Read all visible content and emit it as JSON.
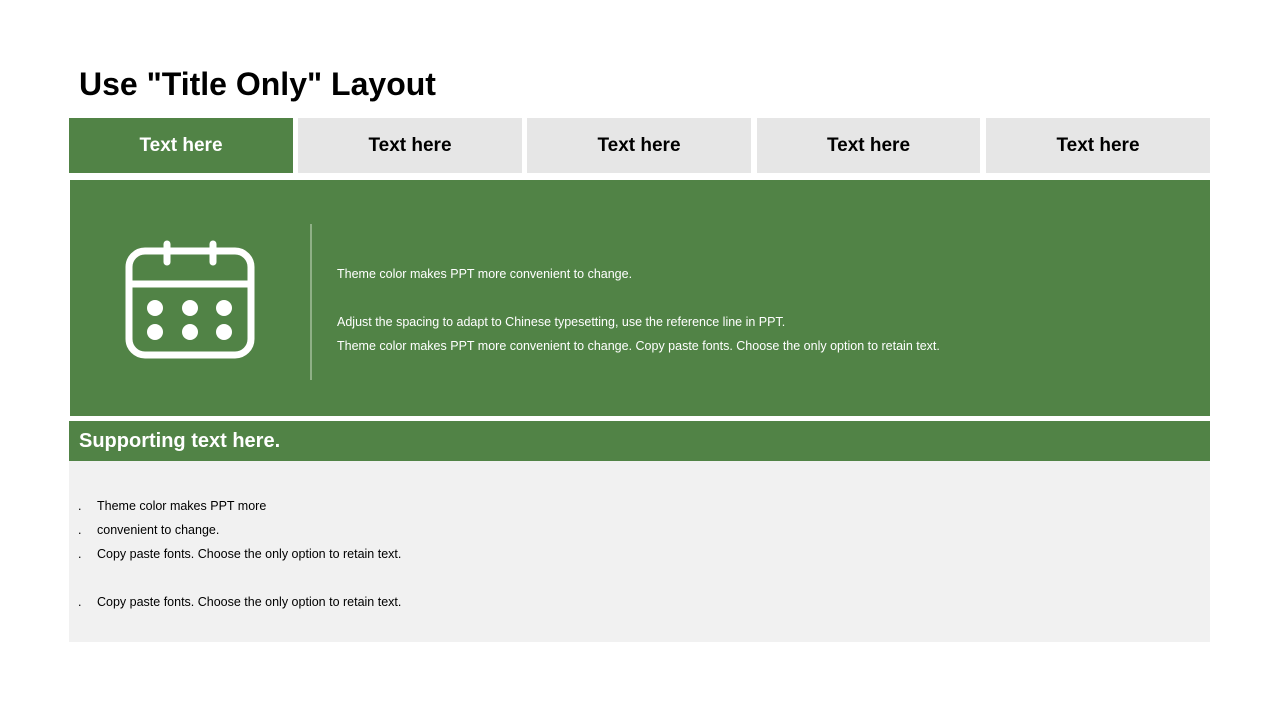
{
  "slide": {
    "title": "Use \"Title Only\" Layout",
    "tabs": [
      {
        "label": "Text here",
        "active": true
      },
      {
        "label": "Text here",
        "active": false
      },
      {
        "label": "Text here",
        "active": false
      },
      {
        "label": "Text here",
        "active": false
      },
      {
        "label": "Text here",
        "active": false
      }
    ],
    "panel": {
      "icon": "calendar-icon",
      "lines": [
        "Theme color makes PPT more convenient to change.",
        "Adjust the spacing to adapt to Chinese typesetting, use the reference line in PPT.",
        "Theme color makes PPT more convenient to change. Copy paste fonts. Choose the only option to retain text."
      ]
    },
    "support": {
      "title": "Supporting text here.",
      "bullet_marker": ".",
      "bullets": [
        "Theme color makes PPT more",
        "convenient to change.",
        "Copy paste fonts. Choose the only option to retain text.",
        "Copy paste fonts. Choose the only option to retain text."
      ]
    },
    "colors": {
      "accent": "#518346",
      "tab_inactive": "#e6e6e6",
      "bullet_background": "#f1f1f1"
    }
  }
}
